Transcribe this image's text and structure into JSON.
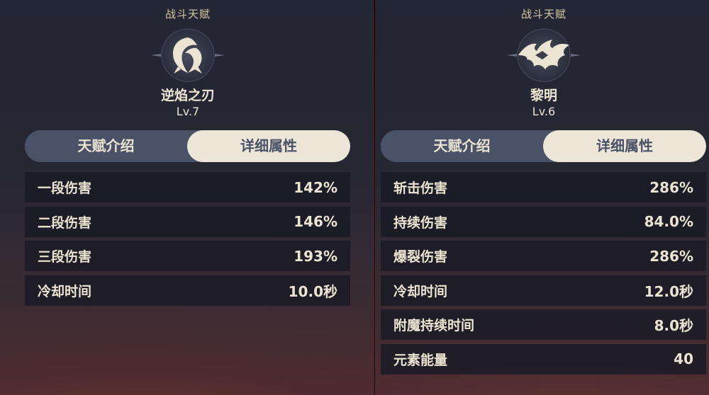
{
  "panels": [
    {
      "category": "战斗天赋",
      "icon": "swirl-blade-icon",
      "name": "逆焰之刃",
      "level": "Lv.7",
      "tabs": [
        {
          "label": "天赋介绍",
          "active": false
        },
        {
          "label": "详细属性",
          "active": true
        }
      ],
      "rows": [
        {
          "label": "一段伤害",
          "value": "142%"
        },
        {
          "label": "二段伤害",
          "value": "146%"
        },
        {
          "label": "三段伤害",
          "value": "193%"
        },
        {
          "label": "冷却时间",
          "value": "10.0秒"
        }
      ]
    },
    {
      "category": "战斗天赋",
      "icon": "flame-wings-icon",
      "name": "黎明",
      "level": "Lv.6",
      "tabs": [
        {
          "label": "天赋介绍",
          "active": false
        },
        {
          "label": "详细属性",
          "active": true
        }
      ],
      "rows": [
        {
          "label": "斩击伤害",
          "value": "286%"
        },
        {
          "label": "持续伤害",
          "value": "84.0%"
        },
        {
          "label": "爆裂伤害",
          "value": "286%"
        },
        {
          "label": "冷却时间",
          "value": "12.0秒"
        },
        {
          "label": "附魔持续时间",
          "value": "8.0秒"
        },
        {
          "label": "元素能量",
          "value": "40"
        }
      ]
    }
  ],
  "colors": {
    "tab_active_bg": "#ece5d8",
    "tab_inactive_bg": "#4a5268",
    "text_light": "#ece4d2",
    "category_text": "#d9c9a4"
  }
}
